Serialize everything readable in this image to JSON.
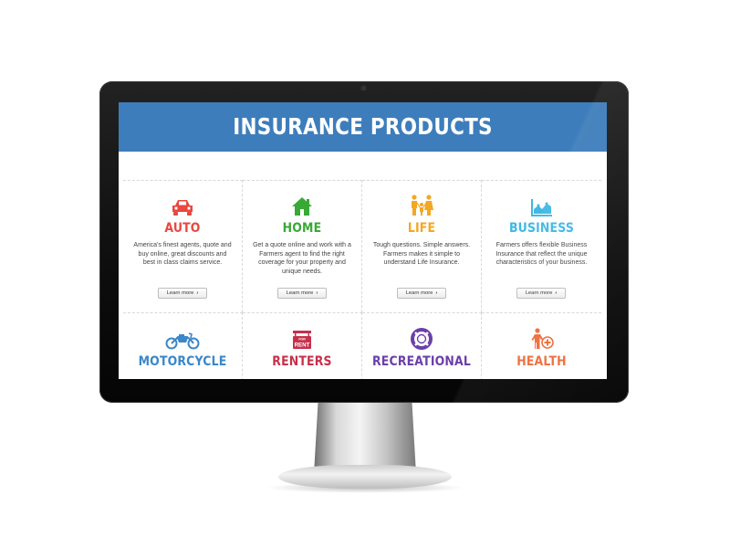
{
  "banner": {
    "title": "INSURANCE PRODUCTS"
  },
  "products_row1": [
    {
      "name": "AUTO",
      "icon": "car-icon",
      "color": "#e9473f",
      "description": "America's finest agents, quote and buy online, great discounts and best in class claims service.",
      "button": "Learn more"
    },
    {
      "name": "HOME",
      "icon": "house-icon",
      "color": "#39a935",
      "description": "Get a quote online and work with a Farmers agent to find the right coverage for your property and unique needs.",
      "button": "Learn more"
    },
    {
      "name": "LIFE",
      "icon": "family-icon",
      "color": "#f5a623",
      "description": "Tough questions. Simple answers. Farmers makes it simple to understand Life Insurance.",
      "button": "Learn more"
    },
    {
      "name": "BUSINESS",
      "icon": "chart-icon",
      "color": "#3fb8e3",
      "description": "Farmers offers flexible Business Insurance that reflect the unique characteristics of your business.",
      "button": "Learn more"
    }
  ],
  "products_row2": [
    {
      "name": "MOTORCYCLE",
      "icon": "motorcycle-icon",
      "color": "#3a87c9"
    },
    {
      "name": "RENTERS",
      "icon": "for-rent-sign-icon",
      "color": "#c7304b",
      "icon_text_small": "FOR",
      "icon_text_big": "RENT"
    },
    {
      "name": "RECREATIONAL",
      "icon": "life-ring-icon",
      "color": "#6b3fa8"
    },
    {
      "name": "HEALTH",
      "icon": "medical-person-icon",
      "color": "#ef6c3a"
    }
  ]
}
